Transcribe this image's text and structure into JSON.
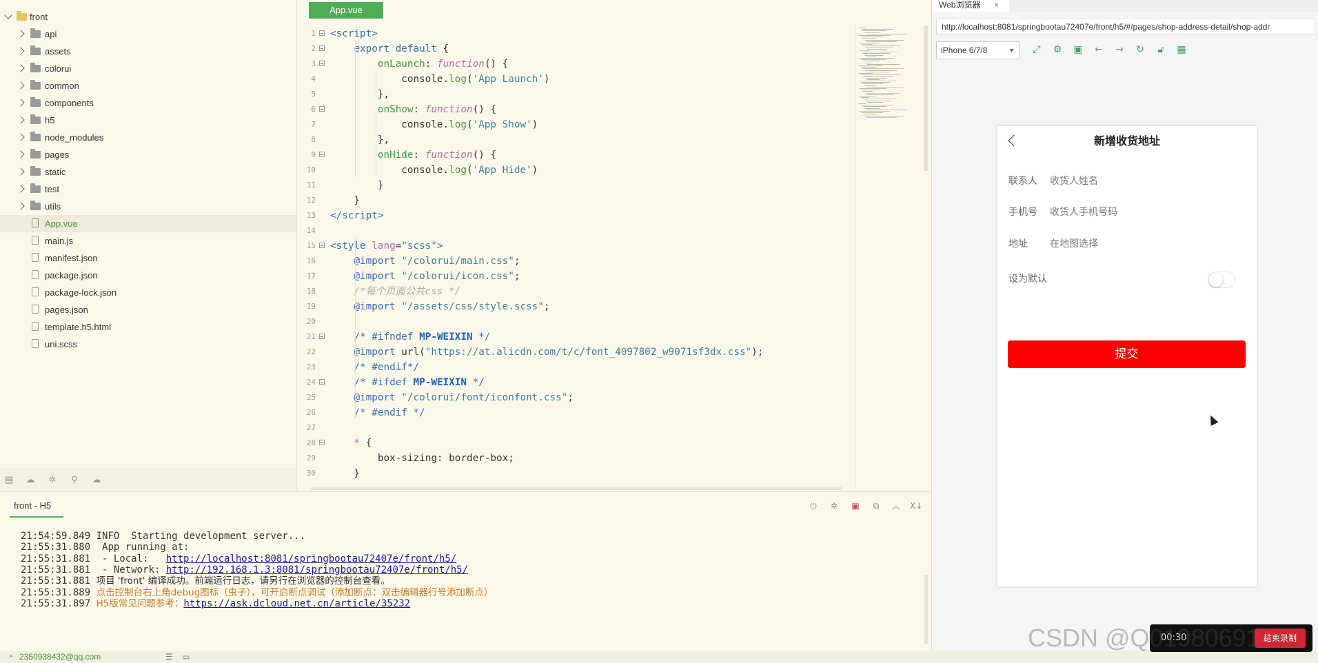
{
  "sidebar": {
    "root": "front",
    "items": [
      {
        "label": "api",
        "kind": "folder"
      },
      {
        "label": "assets",
        "kind": "folder"
      },
      {
        "label": "colorui",
        "kind": "folder"
      },
      {
        "label": "common",
        "kind": "folder"
      },
      {
        "label": "components",
        "kind": "folder"
      },
      {
        "label": "h5",
        "kind": "folder"
      },
      {
        "label": "node_modules",
        "kind": "folder"
      },
      {
        "label": "pages",
        "kind": "folder"
      },
      {
        "label": "static",
        "kind": "folder"
      },
      {
        "label": "test",
        "kind": "folder"
      },
      {
        "label": "utils",
        "kind": "folder"
      },
      {
        "label": "App.vue",
        "kind": "vue",
        "active": true
      },
      {
        "label": "main.js",
        "kind": "file"
      },
      {
        "label": "manifest.json",
        "kind": "file"
      },
      {
        "label": "package.json",
        "kind": "file"
      },
      {
        "label": "package-lock.json",
        "kind": "file"
      },
      {
        "label": "pages.json",
        "kind": "file"
      },
      {
        "label": "template.h5.html",
        "kind": "file"
      },
      {
        "label": "uni.scss",
        "kind": "file"
      }
    ]
  },
  "editor": {
    "tab": "App.vue",
    "lines": [
      {
        "n": "1",
        "fold": true,
        "html": "<span class='t-tag'>&lt;script&gt;</span>"
      },
      {
        "n": "2",
        "fold": true,
        "html": "    <span class='t-kw'>export default</span> {"
      },
      {
        "n": "3",
        "fold": true,
        "html": "        <span class='t-prop'>onLaunch</span>: <span class='t-fn'>function</span>() {"
      },
      {
        "n": "4",
        "html": "            console.<span class='t-prop'>log</span>(<span class='t-str'>'App Launch'</span>)"
      },
      {
        "n": "5",
        "html": "        },"
      },
      {
        "n": "6",
        "fold": true,
        "html": "        <span class='t-prop'>onShow</span>: <span class='t-fn'>function</span>() {"
      },
      {
        "n": "7",
        "html": "            console.<span class='t-prop'>log</span>(<span class='t-str'>'App Show'</span>)"
      },
      {
        "n": "8",
        "html": "        },"
      },
      {
        "n": "9",
        "fold": true,
        "html": "        <span class='t-prop'>onHide</span>: <span class='t-fn'>function</span>() {"
      },
      {
        "n": "10",
        "html": "            console.<span class='t-prop'>log</span>(<span class='t-str'>'App Hide'</span>)"
      },
      {
        "n": "11",
        "html": "        }"
      },
      {
        "n": "12",
        "html": "    }"
      },
      {
        "n": "13",
        "html": "<span class='t-tag'>&lt;/script&gt;</span>"
      },
      {
        "n": "14",
        "html": ""
      },
      {
        "n": "15",
        "fold": true,
        "html": "<span class='t-tag'>&lt;style</span> <span class='t-attr'>lang</span>=<span class='t-str'>\"scss\"</span><span class='t-tag'>&gt;</span>"
      },
      {
        "n": "16",
        "html": "    <span class='t-pp'>@import</span> <span class='t-str'>\"/colorui/main.css\"</span>;"
      },
      {
        "n": "17",
        "html": "    <span class='t-pp'>@import</span> <span class='t-str'>\"/colorui/icon.css\"</span>;"
      },
      {
        "n": "18",
        "html": "    <span class='t-cm'>/*每个页面公共css */</span>"
      },
      {
        "n": "19",
        "html": "    <span class='t-pp'>@import</span> <span class='t-str'>\"/assets/css/style.scss\"</span>;"
      },
      {
        "n": "20",
        "html": ""
      },
      {
        "n": "21",
        "fold": true,
        "html": "    <span class='t-pp'>/* #ifndef</span> <span class='t-mac'>MP-WEIXIN</span> <span class='t-pp'>*/</span>"
      },
      {
        "n": "22",
        "html": "    <span class='t-pp'>@import</span> url(<span class='t-str'>\"https://at.alicdn.com/t/c/font_4097802_w9071sf3dx.css\"</span>);"
      },
      {
        "n": "23",
        "html": "    <span class='t-pp'>/* #endif*/</span>"
      },
      {
        "n": "24",
        "fold": true,
        "html": "    <span class='t-pp'>/* #ifdef</span> <span class='t-mac'>MP-WEIXIN</span> <span class='t-pp'>*/</span>"
      },
      {
        "n": "25",
        "html": "    <span class='t-pp'>@import</span> <span class='t-str'>\"/colorui/font/iconfont.css\"</span>;"
      },
      {
        "n": "26",
        "html": "    <span class='t-pp'>/* #endif */</span>"
      },
      {
        "n": "27",
        "html": ""
      },
      {
        "n": "28",
        "fold": true,
        "html": "    <span class='t-sel'>*</span> {"
      },
      {
        "n": "29",
        "html": "        box-sizing: border-box;"
      },
      {
        "n": "30",
        "html": "    }"
      }
    ]
  },
  "console": {
    "tab": "front - H5",
    "lines": [
      {
        "time": "21:54:59.849",
        "html": " INFO  Starting development server..."
      },
      {
        "time": "21:55:31.880",
        "html": "  App running at:"
      },
      {
        "time": "21:55:31.881",
        "html": "  - Local:   <span class='u'>http://localhost:8081/springbootau72407e/front/h5/</span>"
      },
      {
        "time": "21:55:31.881",
        "html": "  - Network: <span class='u'>http://192.168.1.3:8081/springbootau72407e/front/h5/</span>"
      },
      {
        "time": "21:55:31.881",
        "html": " <span class='cn'>项目 'front' 编译成功。前端运行日志，请另行在浏览器的控制台查看。</span>"
      },
      {
        "time": "21:55:31.889",
        "html": " <span class='w'>点击控制台右上角debug图标（虫子），可开启断点调试（添加断点：双击编辑器行号添加断点）</span>"
      },
      {
        "time": "21:55:31.897",
        "html": " <span class='w'>H5版常见问题参考：</span><span class='u'>https://ask.dcloud.net.cn/article/35232</span>"
      }
    ]
  },
  "statusbar": {
    "account": "2350938432@qq.com"
  },
  "browser": {
    "tab": "Web浏览器",
    "tab_close": "×",
    "url": "http://localhost:8081/springbootau72407e/front/h5/#/pages/shop-address-detail/shop-addr",
    "device": "iPhone 6/7/8"
  },
  "phone": {
    "title": "新增收货地址",
    "fields": [
      {
        "label": "联系人",
        "placeholder": "收货人姓名"
      },
      {
        "label": "手机号",
        "placeholder": "收货人手机号码"
      },
      {
        "label": "地址",
        "placeholder": "在地图选择"
      }
    ],
    "default_label": "设为默认",
    "submit": "提交"
  },
  "overlay": {
    "watermark": "CSDN @Q01980691580",
    "rec_time": "00:30",
    "rec_button": "结束录制"
  },
  "colors": {
    "accent_green": "#4fad58",
    "submit_red": "#ff0000",
    "editor_bg": "#fbf8ea"
  }
}
